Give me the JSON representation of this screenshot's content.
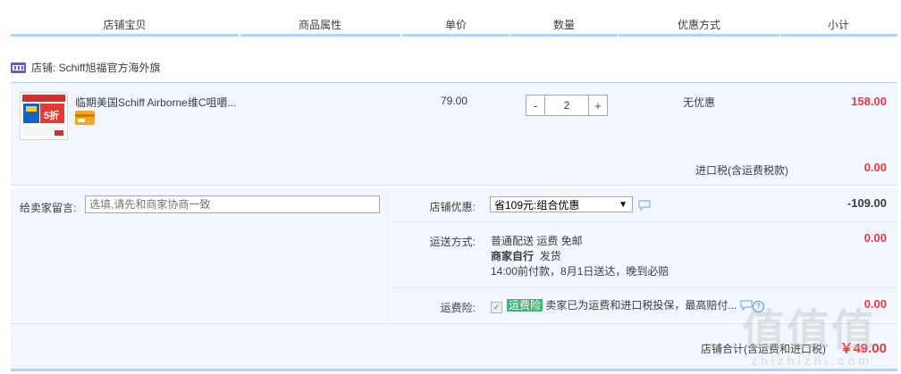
{
  "columns": [
    "店铺宝贝",
    "商品属性",
    "单价",
    "数量",
    "优惠方式",
    "小计"
  ],
  "store": {
    "label": "店铺: Schiff旭福官方海外旗"
  },
  "item": {
    "title": "临期美国Schiff Airborne维C咀嚼...",
    "thumb_text": "5折",
    "price": "79.00",
    "quantity": "2",
    "minus": "-",
    "plus": "+",
    "promo": "无优惠",
    "subtotal": "158.00"
  },
  "tax": {
    "label": "进口税(含运费税款)",
    "value": "0.00"
  },
  "message": {
    "label": "给卖家留言:",
    "placeholder": "选填,请先和商家协商一致"
  },
  "store_discount": {
    "label": "店铺优惠:",
    "selected": "省109元:组合优惠",
    "value": "-109.00"
  },
  "shipping": {
    "label": "运送方式:",
    "line1": "普通配送 运费 免邮",
    "line2_bold": "商家自行",
    "line2_rest": "发货",
    "line3": "14:00前付款，8月1日送达，晚到必赔",
    "value": "0.00"
  },
  "insurance": {
    "label": "运费险:",
    "tag": "运费险",
    "text": "卖家已为运费和进口税投保，最高赔付...",
    "value": "0.00"
  },
  "total": {
    "label": "店铺合计(含运费和进口税)",
    "value": "￥49.00"
  },
  "watermark": {
    "main": "值值值",
    "sub": "zhizhizhi.com"
  },
  "colors": {
    "accent_red": "#e4393c",
    "border_blue": "#b2d1ff",
    "bg_blue": "#f2f7ff",
    "tag_green": "#3cb371"
  }
}
